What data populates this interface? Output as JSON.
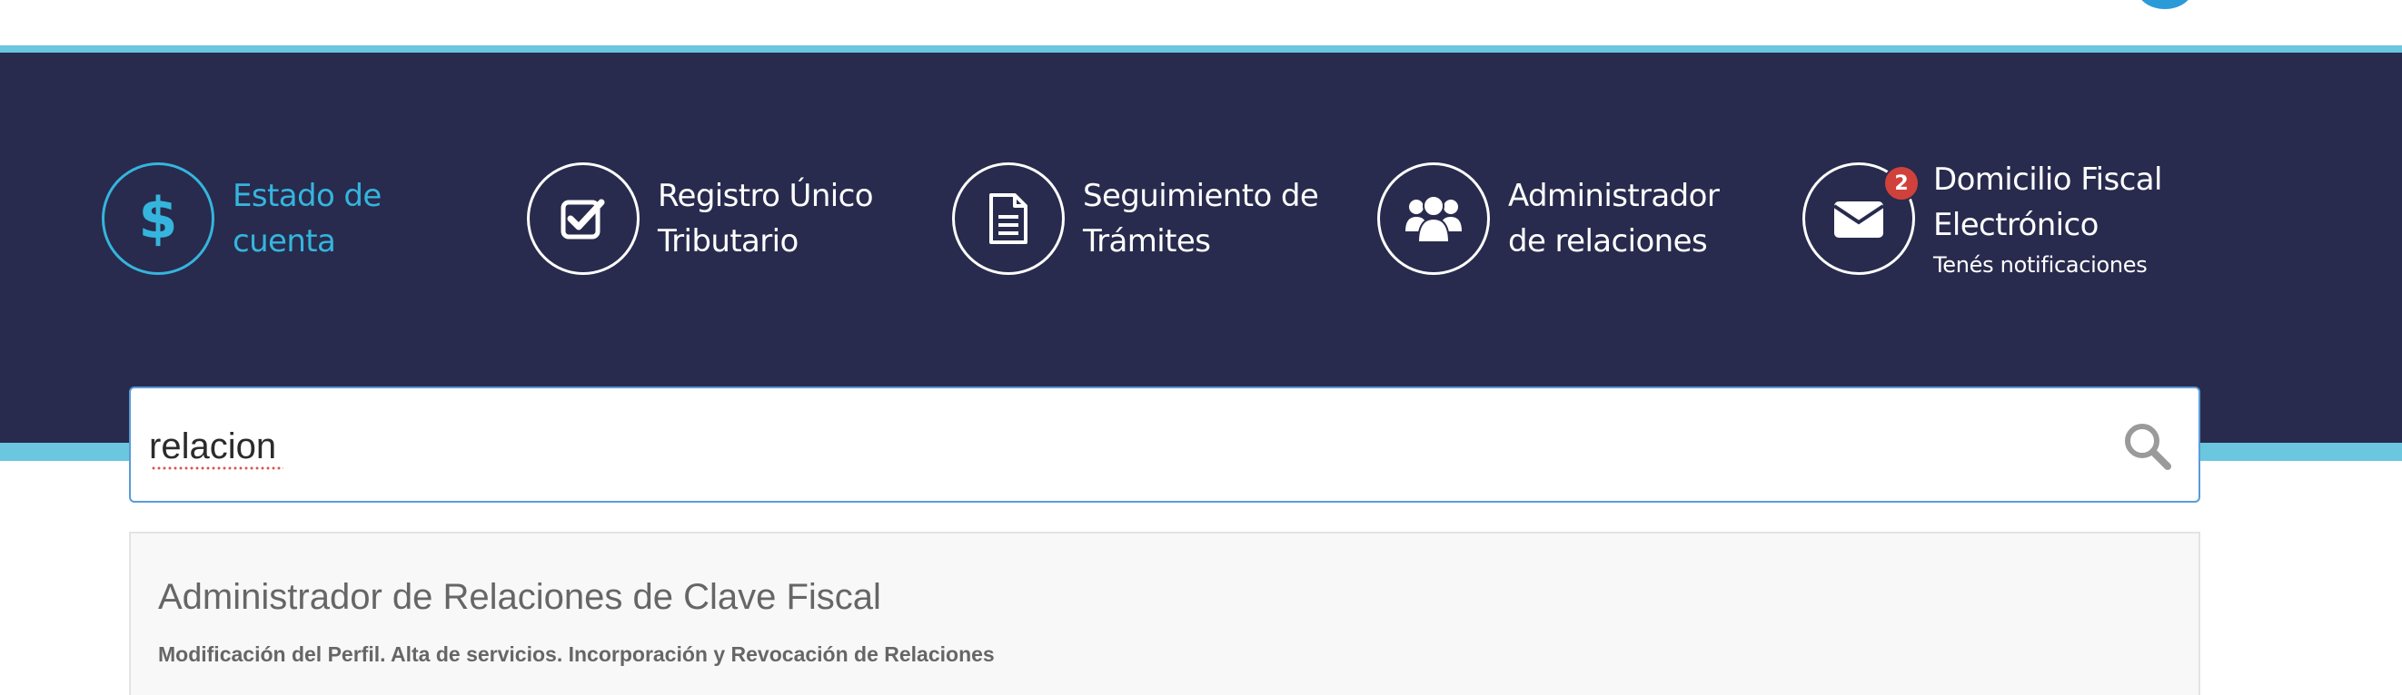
{
  "colors": {
    "dark_band": "#282b4d",
    "accent_cyan": "#35b5dd",
    "light_line": "#6bc6df",
    "badge_red": "#d1413c",
    "search_border": "#5b9bd8",
    "suggestion_text": "#666666"
  },
  "shortcuts": [
    {
      "icon": "dollar-icon",
      "lines": [
        "Estado de",
        "cuenta"
      ],
      "active": true
    },
    {
      "icon": "checkbox-icon",
      "lines": [
        "Registro Único",
        "Tributario"
      ],
      "active": false
    },
    {
      "icon": "document-icon",
      "lines": [
        "Seguimiento de",
        "Trámites"
      ],
      "active": false
    },
    {
      "icon": "users-icon",
      "lines": [
        "Administrador",
        "de relaciones"
      ],
      "active": false
    },
    {
      "icon": "envelope-icon",
      "lines": [
        "Domicilio Fiscal",
        "Electrónico"
      ],
      "sublabel": "Tenés notificaciones",
      "badge": "2",
      "active": false
    }
  ],
  "search": {
    "value": "relacion",
    "icon": "search-icon"
  },
  "suggestion": {
    "title": "Administrador de Relaciones de Clave Fiscal",
    "description": "Modificación del Perfil. Alta de servicios. Incorporación y Revocación de Relaciones"
  }
}
